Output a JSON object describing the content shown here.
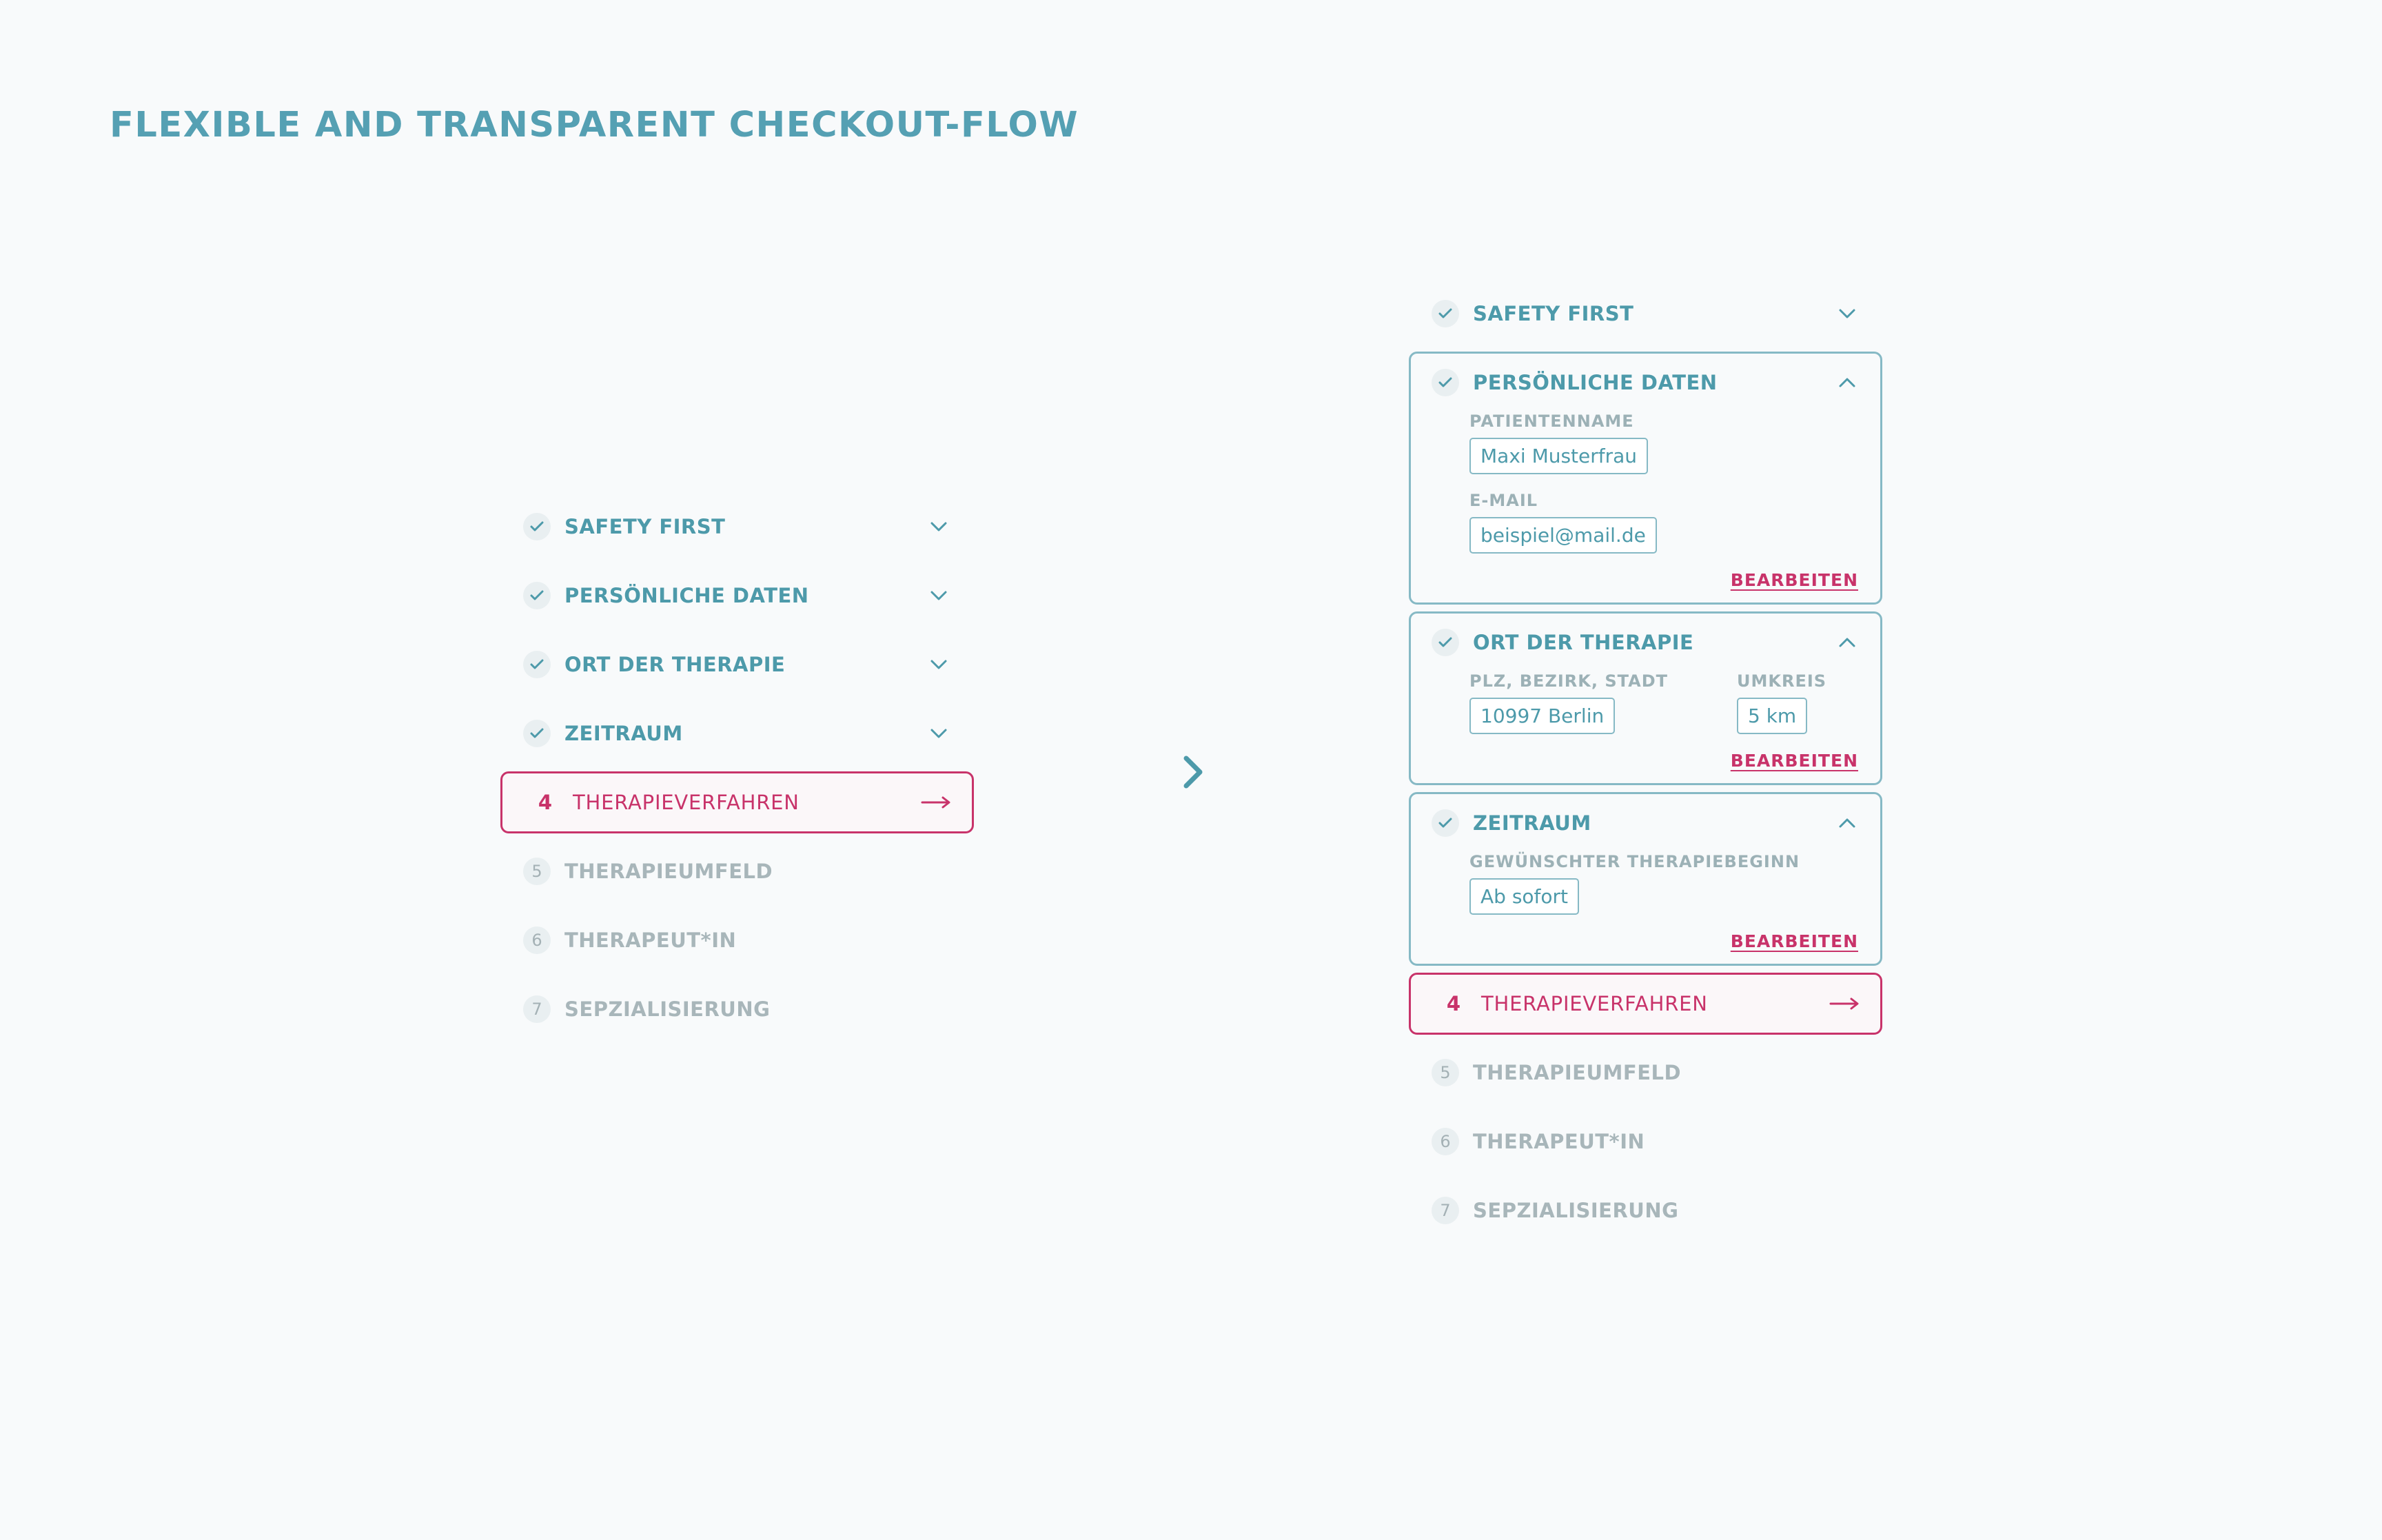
{
  "page_title": "FLEXIBLE AND TRANSPARENT CHECKOUT-FLOW",
  "colors": {
    "background": "#f8fafb",
    "primary": "#4d9aaa",
    "accent": "#c8336a",
    "muted": "#a8b6ba",
    "card_border": "#86b9c5"
  },
  "icons": {
    "done": "check-icon",
    "collapsed": "chevron-down-icon",
    "expanded": "chevron-up-icon",
    "active": "arrow-right-icon",
    "between": "chevron-right-icon"
  },
  "left_flow": {
    "completed": [
      {
        "label": "SAFETY FIRST"
      },
      {
        "label": "PERSÖNLICHE DATEN"
      },
      {
        "label": "ORT DER THERAPIE"
      },
      {
        "label": "ZEITRAUM"
      }
    ],
    "active": {
      "number": "4",
      "label": "THERAPIEVERFAHREN"
    },
    "pending": [
      {
        "number": "5",
        "label": "THERAPIEUMFELD"
      },
      {
        "number": "6",
        "label": "THERAPEUT*IN"
      },
      {
        "number": "7",
        "label": "SEPZIALISIERUNG"
      }
    ]
  },
  "right_flow": {
    "collapsed_step": {
      "label": "SAFETY FIRST"
    },
    "personal_data": {
      "label": "PERSÖNLICHE DATEN",
      "name_label": "PATIENTENNAME",
      "name_value": "Maxi Musterfrau",
      "email_label": "E-MAIL",
      "email_value": "beispiel@mail.de",
      "edit": "BEARBEITEN"
    },
    "location": {
      "label": "ORT DER THERAPIE",
      "place_label": "PLZ, BEZIRK, STADT",
      "place_value": "10997 Berlin",
      "radius_label": "UMKREIS",
      "radius_value": "5 km",
      "edit": "BEARBEITEN"
    },
    "timeframe": {
      "label": "ZEITRAUM",
      "start_label": "GEWÜNSCHTER THERAPIEBEGINN",
      "start_value": "Ab sofort",
      "edit": "BEARBEITEN"
    },
    "active": {
      "number": "4",
      "label": "THERAPIEVERFAHREN"
    },
    "pending": [
      {
        "number": "5",
        "label": "THERAPIEUMFELD"
      },
      {
        "number": "6",
        "label": "THERAPEUT*IN"
      },
      {
        "number": "7",
        "label": "SEPZIALISIERUNG"
      }
    ]
  }
}
